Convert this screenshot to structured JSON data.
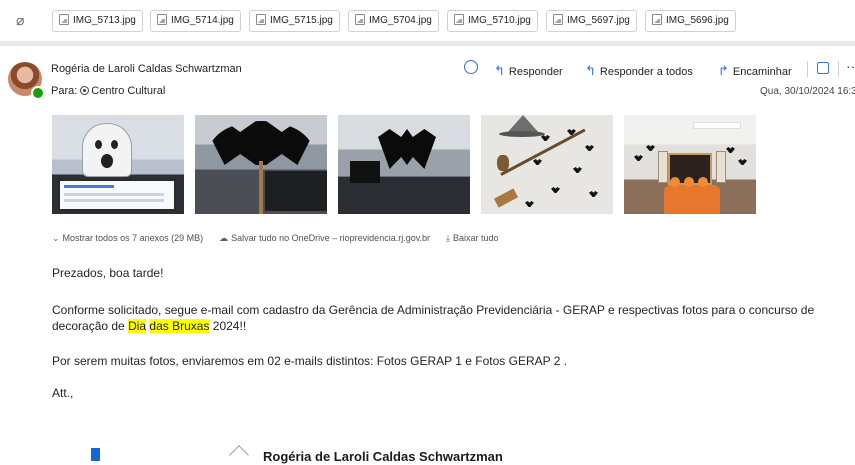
{
  "attachments": {
    "chips": [
      "IMG_5713.jpg",
      "IMG_5714.jpg",
      "IMG_5715.jpg",
      "IMG_5704.jpg",
      "IMG_5710.jpg",
      "IMG_5697.jpg",
      "IMG_5696.jpg"
    ],
    "show_all": "Mostrar todos os 7 anexos (29 MB)",
    "save_onedrive": "Salvar tudo no OneDrive – rioprevidencia.rj.gov.br",
    "download_all": "Baixar tudo"
  },
  "header": {
    "sender": "Rogéria de Laroli Caldas Schwartzman",
    "to_label": "Para:",
    "to_value": "Centro Cultural",
    "reply": "Responder",
    "reply_all": "Responder a todos",
    "forward": "Encaminhar",
    "date": "Qua, 30/10/2024 16:3"
  },
  "body": {
    "greeting": "Prezados, boa tarde!",
    "para1_a": "Conforme solicitado, segue e-mail com cadastro da Gerência de Administração Previdenciária - GERAP e respectivas fotos para o concurso de decoração de ",
    "para1_hl1": "Dia",
    "para1_sp": " ",
    "para1_hl2": "das Bruxas",
    "para1_b": " 2024!!",
    "para2": "Por serem muitas fotos, enviaremos em 02 e-mails distintos: Fotos GERAP 1 e Fotos GERAP 2 .",
    "closing": "Att.,"
  },
  "signature": {
    "name": "Rogéria de Laroli Caldas Schwartzman"
  },
  "colors": {
    "accent": "#3b6fd1",
    "highlight": "#ffff00",
    "presence": "#13a10e"
  }
}
